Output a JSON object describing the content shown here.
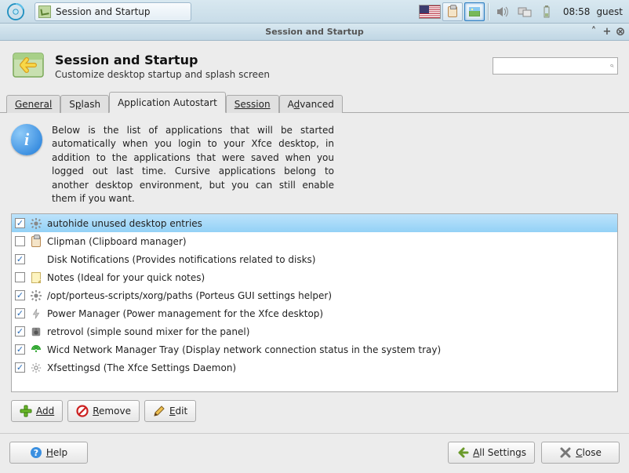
{
  "panel": {
    "taskbar_item": "Session and Startup",
    "clock": "08:58",
    "user": "guest"
  },
  "titlebar": {
    "title": "Session and Startup"
  },
  "header": {
    "title": "Session and Startup",
    "subtitle": "Customize desktop startup and splash screen"
  },
  "search": {
    "placeholder": ""
  },
  "tabs": {
    "general": "General",
    "splash": "Splash",
    "autostart": "Application Autostart",
    "session": "Session",
    "advanced": "Advanced"
  },
  "info_text": "Below is the list of applications that will be started automatically when you login to your Xfce desktop, in addition to the applications that were saved when you logged out last time. Cursive applications belong to another desktop environment, but you can still enable them if you want.",
  "apps": [
    {
      "checked": true,
      "icon": "gear",
      "label": "autohide unused desktop entries",
      "selected": true
    },
    {
      "checked": false,
      "icon": "clip",
      "label": "Clipman (Clipboard manager)"
    },
    {
      "checked": true,
      "icon": "none",
      "label": "Disk Notifications (Provides notifications related to disks)"
    },
    {
      "checked": false,
      "icon": "note",
      "label": "Notes (Ideal for your quick notes)"
    },
    {
      "checked": true,
      "icon": "gear",
      "label": "/opt/porteus-scripts/xorg/paths (Porteus GUI settings helper)"
    },
    {
      "checked": true,
      "icon": "bolt",
      "label": "Power Manager (Power management for the Xfce desktop)"
    },
    {
      "checked": true,
      "icon": "speaker",
      "label": "retrovol (simple sound mixer for the panel)"
    },
    {
      "checked": true,
      "icon": "net",
      "label": "Wicd Network Manager Tray (Display network connection status in the system tray)"
    },
    {
      "checked": true,
      "icon": "cog",
      "label": "Xfsettingsd (The Xfce Settings Daemon)"
    }
  ],
  "buttons": {
    "add": "Add",
    "remove": "Remove",
    "edit": "Edit",
    "help": "Help",
    "all_settings": "All Settings",
    "close": "Close"
  }
}
